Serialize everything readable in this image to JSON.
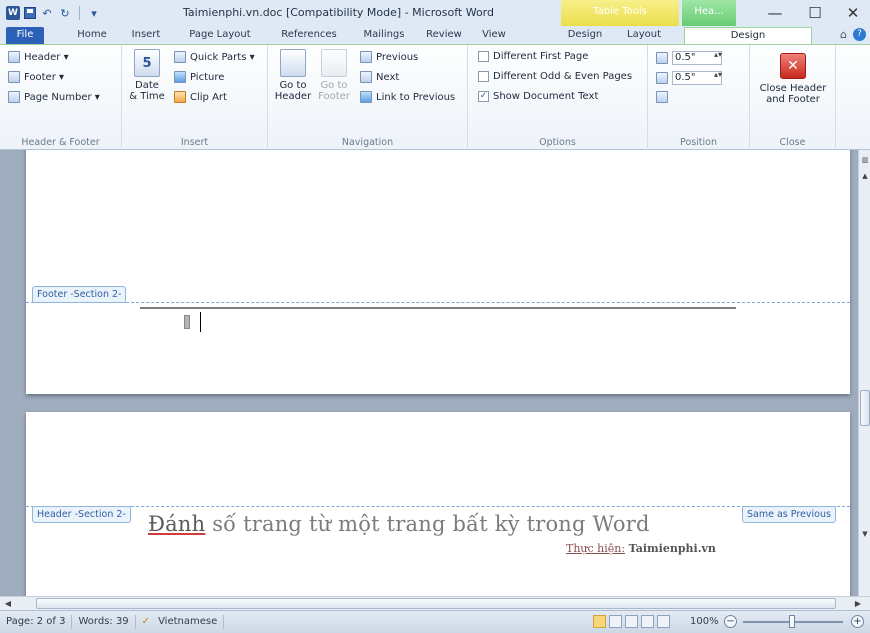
{
  "window": {
    "title": "Taimienphi.vn.doc [Compatibility Mode] - Microsoft Word",
    "contextual_table_tools": "Table Tools",
    "contextual_header_tools": "Hea...",
    "minimize": "—",
    "maximize": "☐",
    "close": "✕"
  },
  "qat": {
    "logo": "W",
    "undo": "↶",
    "redo": "↻",
    "customize": "▾"
  },
  "tabs": {
    "file": "File",
    "home": "Home",
    "insert": "Insert",
    "page_layout": "Page Layout",
    "references": "References",
    "mailings": "Mailings",
    "review": "Review",
    "view": "View",
    "design_table": "Design",
    "layout": "Layout",
    "design_header": "Design"
  },
  "ribbon": {
    "header_footer": {
      "label": "Header & Footer",
      "header": "Header ▾",
      "footer": "Footer ▾",
      "page_number": "Page Number ▾"
    },
    "insert": {
      "label": "Insert",
      "date_time": "Date\n& Time",
      "quick_parts": "Quick Parts ▾",
      "picture": "Picture",
      "clip_art": "Clip Art",
      "date_icon_number": "5"
    },
    "navigation": {
      "label": "Navigation",
      "go_to_header": "Go to\nHeader",
      "go_to_footer": "Go to\nFooter",
      "previous": "Previous",
      "next": "Next",
      "link_to_previous": "Link to Previous"
    },
    "options": {
      "label": "Options",
      "different_first_page": "Different First Page",
      "different_odd_even": "Different Odd & Even Pages",
      "show_document_text": "Show Document Text",
      "show_document_text_checked": "✓"
    },
    "position": {
      "label": "Position",
      "header_from_top": "0.5\"",
      "footer_from_bottom": "0.5\""
    },
    "close": {
      "label": "Close",
      "close_header_footer": "Close Header\nand Footer",
      "close_icon": "✕"
    }
  },
  "document": {
    "footer_section_tag": "Footer -Section 2-",
    "header_section_tag": "Header -Section 2-",
    "same_as_previous": "Same as Previous",
    "heading_first_word": "Đánh",
    "heading_rest": " số trang từ một trang bất kỳ trong Word",
    "byline_prefix": "Thực hiện:",
    "byline_site": "Taimienphi.vn"
  },
  "statusbar": {
    "page": "Page: 2 of 3",
    "words": "Words: 39",
    "language": "Vietnamese",
    "zoom": "100%",
    "zoom_minus": "−",
    "zoom_plus": "+"
  }
}
